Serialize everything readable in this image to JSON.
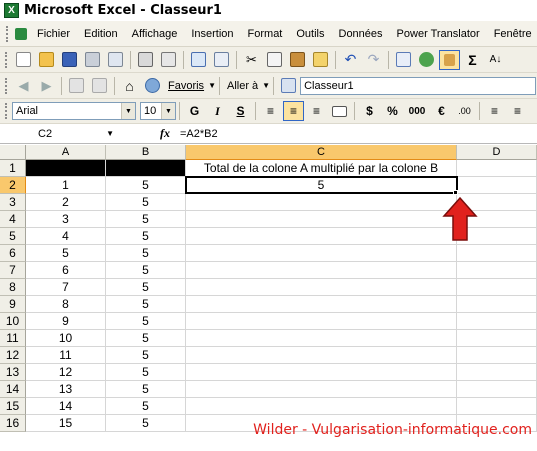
{
  "window": {
    "title": "Microsoft Excel - Classeur1",
    "app_icon": "excel-icon"
  },
  "menu": {
    "items": [
      "Fichier",
      "Edition",
      "Affichage",
      "Insertion",
      "Format",
      "Outils",
      "Données",
      "Power Translator",
      "Fenêtre"
    ]
  },
  "toolbar2": {
    "favoris": "Favoris",
    "aller": "Aller à",
    "address": "Classeur1"
  },
  "format": {
    "font": "Arial",
    "size": "10",
    "bold": "G",
    "italic": "I",
    "underline": "S",
    "currency": "$",
    "percent": "%",
    "thousands": "000"
  },
  "formula_bar": {
    "name_box": "C2",
    "fx": "fx",
    "formula": "=A2*B2"
  },
  "sheet": {
    "columns": [
      "A",
      "B",
      "C",
      "D"
    ],
    "selected_column": "C",
    "selected_row": "2",
    "c1_text": "Total de la colone A multiplié par la colone B",
    "c2_value": "5",
    "rows": [
      {
        "n": "1",
        "a": "",
        "b": ""
      },
      {
        "n": "2",
        "a": "1",
        "b": "5"
      },
      {
        "n": "3",
        "a": "2",
        "b": "5"
      },
      {
        "n": "4",
        "a": "3",
        "b": "5"
      },
      {
        "n": "5",
        "a": "4",
        "b": "5"
      },
      {
        "n": "6",
        "a": "5",
        "b": "5"
      },
      {
        "n": "7",
        "a": "6",
        "b": "5"
      },
      {
        "n": "8",
        "a": "7",
        "b": "5"
      },
      {
        "n": "9",
        "a": "8",
        "b": "5"
      },
      {
        "n": "10",
        "a": "9",
        "b": "5"
      },
      {
        "n": "11",
        "a": "10",
        "b": "5"
      },
      {
        "n": "12",
        "a": "11",
        "b": "5"
      },
      {
        "n": "13",
        "a": "12",
        "b": "5"
      },
      {
        "n": "14",
        "a": "13",
        "b": "5"
      },
      {
        "n": "15",
        "a": "14",
        "b": "5"
      },
      {
        "n": "16",
        "a": "15",
        "b": "5"
      }
    ]
  },
  "annotation": {
    "arrow_color": "#e1211d",
    "watermark": "Wilder - Vulgarisation-informatique.com"
  }
}
